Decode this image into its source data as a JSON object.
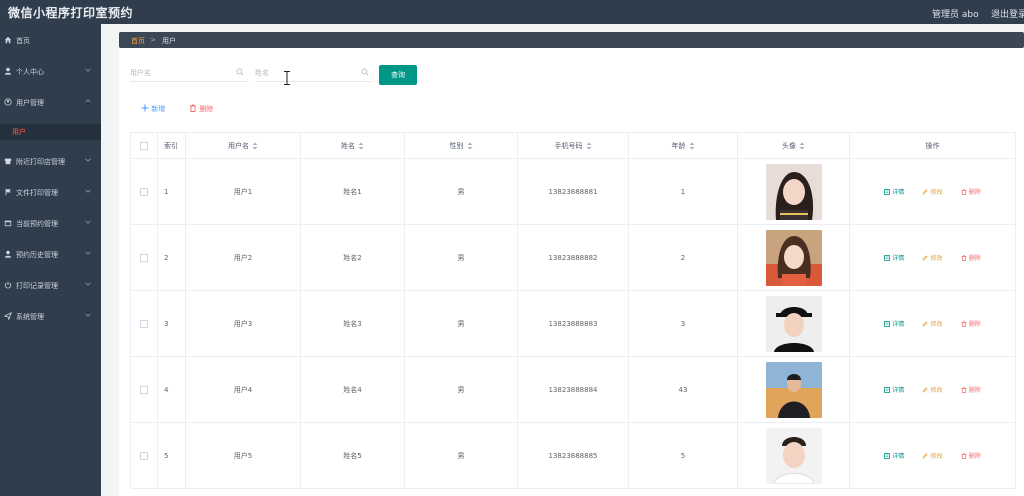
{
  "app": {
    "title": "微信小程序打印室预约",
    "admin": "管理员 abo",
    "logout": "退出登录"
  },
  "sidebar": {
    "items": [
      {
        "label": "首页",
        "icon": "home-icon"
      },
      {
        "label": "个人中心",
        "icon": "person-icon"
      },
      {
        "label": "用户管理",
        "icon": "users-icon",
        "expanded": true
      },
      {
        "label": "附近打印店管理",
        "icon": "store-icon"
      },
      {
        "label": "文件打印管理",
        "icon": "flag-icon"
      },
      {
        "label": "当前预约管理",
        "icon": "calendar-icon"
      },
      {
        "label": "预约历史管理",
        "icon": "person-icon"
      },
      {
        "label": "打印记录管理",
        "icon": "power-icon"
      },
      {
        "label": "系统管理",
        "icon": "send-icon"
      }
    ],
    "sub_item": "用户"
  },
  "breadcrumb": {
    "home": "首页",
    "separator": ">",
    "current": "用户"
  },
  "search": {
    "username_placeholder": "用户名",
    "name_placeholder": "姓名",
    "query_label": "查询"
  },
  "actions": {
    "add_label": "新增",
    "delete_label": "删除"
  },
  "table": {
    "headers": {
      "index": "索引",
      "username": "用户名",
      "name": "姓名",
      "gender": "性别",
      "phone": "手机号码",
      "age": "年龄",
      "avatar": "头像",
      "ops": "操作"
    },
    "rows": [
      {
        "index": "1",
        "username": "用户1",
        "name": "姓名1",
        "gender": "男",
        "phone": "13823888881",
        "age": "1"
      },
      {
        "index": "2",
        "username": "用户2",
        "name": "姓名2",
        "gender": "男",
        "phone": "13823888882",
        "age": "2"
      },
      {
        "index": "3",
        "username": "用户3",
        "name": "姓名3",
        "gender": "男",
        "phone": "13823888883",
        "age": "3"
      },
      {
        "index": "4",
        "username": "用户4",
        "name": "姓名4",
        "gender": "男",
        "phone": "13823888884",
        "age": "43"
      },
      {
        "index": "5",
        "username": "用户5",
        "name": "姓名5",
        "gender": "男",
        "phone": "13823888885",
        "age": "5"
      }
    ],
    "ops": {
      "detail": "详情",
      "edit": "修改",
      "remove": "删除"
    }
  },
  "colors": {
    "sidebar": "#2f3d4c",
    "primary": "#009688",
    "danger": "#f56c6c",
    "warning": "#e6a23c",
    "link": "#409eff",
    "accent": "#ff9f43"
  }
}
